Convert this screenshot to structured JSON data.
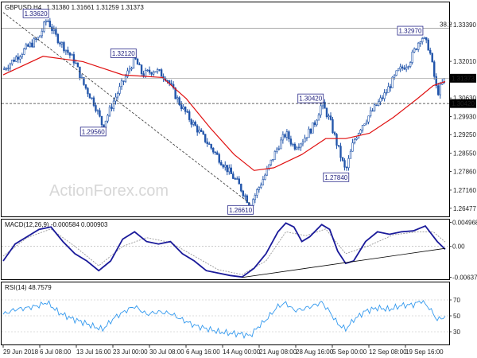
{
  "header": {
    "symbol": "GBPUSD,H4",
    "ohlc": "1.31380 1.31661 1.31259 1.31373",
    "watermark": "ActionForex.com"
  },
  "colors": {
    "background": "#ffffff",
    "candle": "#2255aa",
    "ma": "#e01010",
    "macd_line": "#1a1a9a",
    "macd_signal": "#999999",
    "rsi_line": "#3399ee",
    "box_border": "#2a2a8a"
  },
  "chart_data": [
    {
      "type": "candlestick",
      "panel": "price",
      "title": "GBPUSD,H4",
      "y_ticks": [
        "1.33390",
        "1.32010",
        "1.30630",
        "1.29930",
        "1.29250",
        "1.28550",
        "1.27860",
        "1.27160",
        "1.26477"
      ],
      "ylim": [
        1.262,
        1.342
      ],
      "current_price": "1.31373",
      "support_level": "1.30420",
      "resistance_level": "1.33260",
      "resistance_tag": "38.2",
      "annotations": [
        "1.33620",
        "1.32120",
        "1.29560",
        "1.30420",
        "1.32970",
        "1.27840",
        "1.26610"
      ],
      "x_labels": [
        "29 Jun 2018",
        "6 Jul 08:00",
        "13 Jul 16:00",
        "23 Jul 00:00",
        "30 Jul 08:00",
        "6 Aug 16:00",
        "14 Aug 00:00",
        "21 Aug 08:00",
        "28 Aug 16:00",
        "5 Sep 00:00",
        "12 Sep 08:00",
        "19 Sep 16:00"
      ],
      "price_path": [
        [
          0,
          1.317
        ],
        [
          10,
          1.324
        ],
        [
          18,
          1.329
        ],
        [
          22,
          1.3362
        ],
        [
          26,
          1.33
        ],
        [
          30,
          1.326
        ],
        [
          36,
          1.32
        ],
        [
          40,
          1.312
        ],
        [
          46,
          1.304
        ],
        [
          50,
          1.2956
        ],
        [
          56,
          1.306
        ],
        [
          62,
          1.315
        ],
        [
          66,
          1.3212
        ],
        [
          70,
          1.315
        ],
        [
          76,
          1.317
        ],
        [
          82,
          1.314
        ],
        [
          88,
          1.305
        ],
        [
          94,
          1.298
        ],
        [
          100,
          1.292
        ],
        [
          106,
          1.286
        ],
        [
          112,
          1.28
        ],
        [
          118,
          1.274
        ],
        [
          124,
          1.2661
        ],
        [
          128,
          1.272
        ],
        [
          132,
          1.278
        ],
        [
          138,
          1.288
        ],
        [
          142,
          1.293
        ],
        [
          146,
          1.288
        ],
        [
          150,
          1.29
        ],
        [
          156,
          1.296
        ],
        [
          160,
          1.3042
        ],
        [
          164,
          1.298
        ],
        [
          168,
          1.288
        ],
        [
          172,
          1.2784
        ],
        [
          176,
          1.29
        ],
        [
          180,
          1.296
        ],
        [
          186,
          1.302
        ],
        [
          192,
          1.308
        ],
        [
          198,
          1.316
        ],
        [
          204,
          1.32
        ],
        [
          210,
          1.3297
        ],
        [
          214,
          1.325
        ],
        [
          218,
          1.308
        ],
        [
          222,
          1.3137
        ]
      ],
      "ma_path": [
        [
          0,
          1.315
        ],
        [
          20,
          1.322
        ],
        [
          40,
          1.32
        ],
        [
          60,
          1.315
        ],
        [
          80,
          1.314
        ],
        [
          92,
          1.306
        ],
        [
          104,
          1.295
        ],
        [
          116,
          1.285
        ],
        [
          126,
          1.279
        ],
        [
          136,
          1.28
        ],
        [
          150,
          1.285
        ],
        [
          162,
          1.291
        ],
        [
          172,
          1.291
        ],
        [
          184,
          1.293
        ],
        [
          196,
          1.299
        ],
        [
          208,
          1.306
        ],
        [
          216,
          1.311
        ],
        [
          222,
          1.3125
        ]
      ]
    },
    {
      "type": "line",
      "panel": "macd",
      "title": "MACD(12,26,9) -0.000584 0.000903",
      "y_ticks": [
        "0.004968",
        "0.00",
        "-0.006372"
      ],
      "ylim": [
        -0.0066,
        0.0052
      ],
      "macd_path": [
        [
          0,
          -0.003
        ],
        [
          6,
          0.0005
        ],
        [
          12,
          0.002
        ],
        [
          18,
          0.0035
        ],
        [
          24,
          0.004
        ],
        [
          30,
          0.001
        ],
        [
          36,
          -0.0015
        ],
        [
          42,
          -0.003
        ],
        [
          48,
          -0.005
        ],
        [
          54,
          -0.003
        ],
        [
          60,
          0.0015
        ],
        [
          66,
          0.003
        ],
        [
          72,
          0.001
        ],
        [
          78,
          0.0005
        ],
        [
          84,
          0.001
        ],
        [
          90,
          -0.0015
        ],
        [
          96,
          -0.003
        ],
        [
          102,
          -0.005
        ],
        [
          108,
          -0.0055
        ],
        [
          114,
          -0.006
        ],
        [
          120,
          -0.0063
        ],
        [
          126,
          -0.0045
        ],
        [
          132,
          -0.0015
        ],
        [
          138,
          0.003
        ],
        [
          142,
          0.0048
        ],
        [
          146,
          0.004
        ],
        [
          150,
          0.001
        ],
        [
          154,
          0.002
        ],
        [
          160,
          0.0045
        ],
        [
          164,
          0.0035
        ],
        [
          168,
          -0.001
        ],
        [
          172,
          -0.0035
        ],
        [
          176,
          -0.003
        ],
        [
          182,
          0.001
        ],
        [
          188,
          0.003
        ],
        [
          194,
          0.0025
        ],
        [
          200,
          0.003
        ],
        [
          206,
          0.0032
        ],
        [
          212,
          0.0042
        ],
        [
          218,
          0.001
        ],
        [
          222,
          -0.0006
        ]
      ],
      "signal_path": [
        [
          0,
          -0.002
        ],
        [
          12,
          0.0018
        ],
        [
          24,
          0.0036
        ],
        [
          36,
          0.0
        ],
        [
          48,
          -0.004
        ],
        [
          60,
          0.0
        ],
        [
          72,
          0.0018
        ],
        [
          84,
          0.0008
        ],
        [
          96,
          -0.002
        ],
        [
          108,
          -0.0048
        ],
        [
          120,
          -0.0058
        ],
        [
          132,
          -0.003
        ],
        [
          142,
          0.003
        ],
        [
          152,
          0.0022
        ],
        [
          162,
          0.0036
        ],
        [
          172,
          -0.0015
        ],
        [
          184,
          0.0002
        ],
        [
          196,
          0.0024
        ],
        [
          208,
          0.003
        ],
        [
          216,
          0.003
        ],
        [
          222,
          0.0009
        ]
      ],
      "trendline": [
        [
          120,
          -0.0064
        ],
        [
          222,
          -0.0004
        ]
      ]
    },
    {
      "type": "line",
      "panel": "rsi",
      "title": "RSI(14) 48.7579",
      "y_ticks": [
        "70",
        "50",
        "30"
      ],
      "ylim": [
        15,
        90
      ],
      "rsi_path": [
        [
          0,
          52
        ],
        [
          6,
          58
        ],
        [
          12,
          60
        ],
        [
          18,
          63
        ],
        [
          22,
          67
        ],
        [
          28,
          54
        ],
        [
          34,
          47
        ],
        [
          40,
          42
        ],
        [
          46,
          36
        ],
        [
          50,
          33
        ],
        [
          56,
          48
        ],
        [
          62,
          57
        ],
        [
          66,
          62
        ],
        [
          72,
          52
        ],
        [
          78,
          55
        ],
        [
          84,
          53
        ],
        [
          90,
          45
        ],
        [
          96,
          38
        ],
        [
          102,
          34
        ],
        [
          108,
          30
        ],
        [
          114,
          28
        ],
        [
          120,
          27
        ],
        [
          124,
          25
        ],
        [
          128,
          36
        ],
        [
          132,
          45
        ],
        [
          138,
          62
        ],
        [
          142,
          66
        ],
        [
          146,
          57
        ],
        [
          150,
          58
        ],
        [
          156,
          63
        ],
        [
          160,
          67
        ],
        [
          164,
          55
        ],
        [
          168,
          40
        ],
        [
          172,
          33
        ],
        [
          176,
          45
        ],
        [
          182,
          56
        ],
        [
          188,
          60
        ],
        [
          194,
          58
        ],
        [
          200,
          63
        ],
        [
          206,
          64
        ],
        [
          210,
          69
        ],
        [
          214,
          60
        ],
        [
          218,
          45
        ],
        [
          222,
          49
        ]
      ]
    }
  ]
}
